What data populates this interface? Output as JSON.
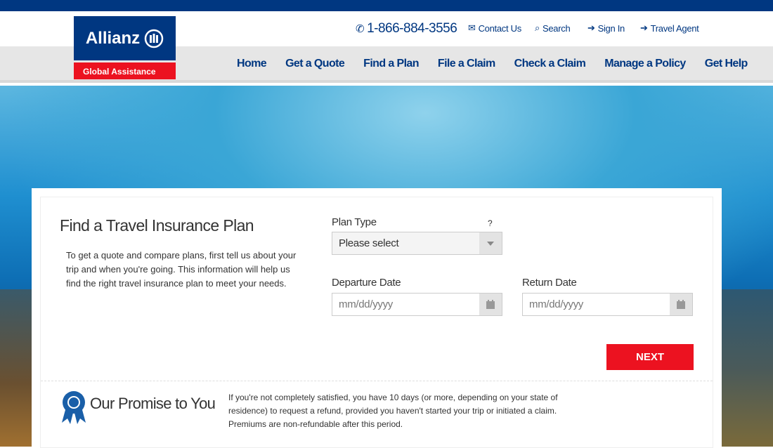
{
  "brand": {
    "name": "Allianz",
    "sub": "Global Assistance",
    "primary": "#003781",
    "accent": "#ec1220"
  },
  "utility": {
    "phone": "1-866-884-3556",
    "contact": "Contact Us",
    "search": "Search",
    "signin": "Sign In",
    "agent": "Travel Agent"
  },
  "nav": [
    "Home",
    "Get a Quote",
    "Find a Plan",
    "File a Claim",
    "Check a Claim",
    "Manage a Policy",
    "Get Help"
  ],
  "form": {
    "title": "Find a Travel Insurance Plan",
    "intro": "To get a quote and compare plans, first tell us about your trip and when you're going.  This information will help us find the right travel insurance plan to meet your needs.",
    "plan_type_label": "Plan Type",
    "help": "?",
    "plan_type_value": "Please select",
    "departure_label": "Departure Date",
    "departure_placeholder": "mm/dd/yyyy",
    "return_label": "Return Date",
    "return_placeholder": "mm/dd/yyyy",
    "next": "NEXT"
  },
  "promise": {
    "title": "Our Promise to You",
    "text": "If you're not completely satisfied, you have 10 days (or more, depending on your state of residence) to request a refund, provided you haven't started your trip or initiated a claim. Premiums are non-refundable after this period."
  }
}
